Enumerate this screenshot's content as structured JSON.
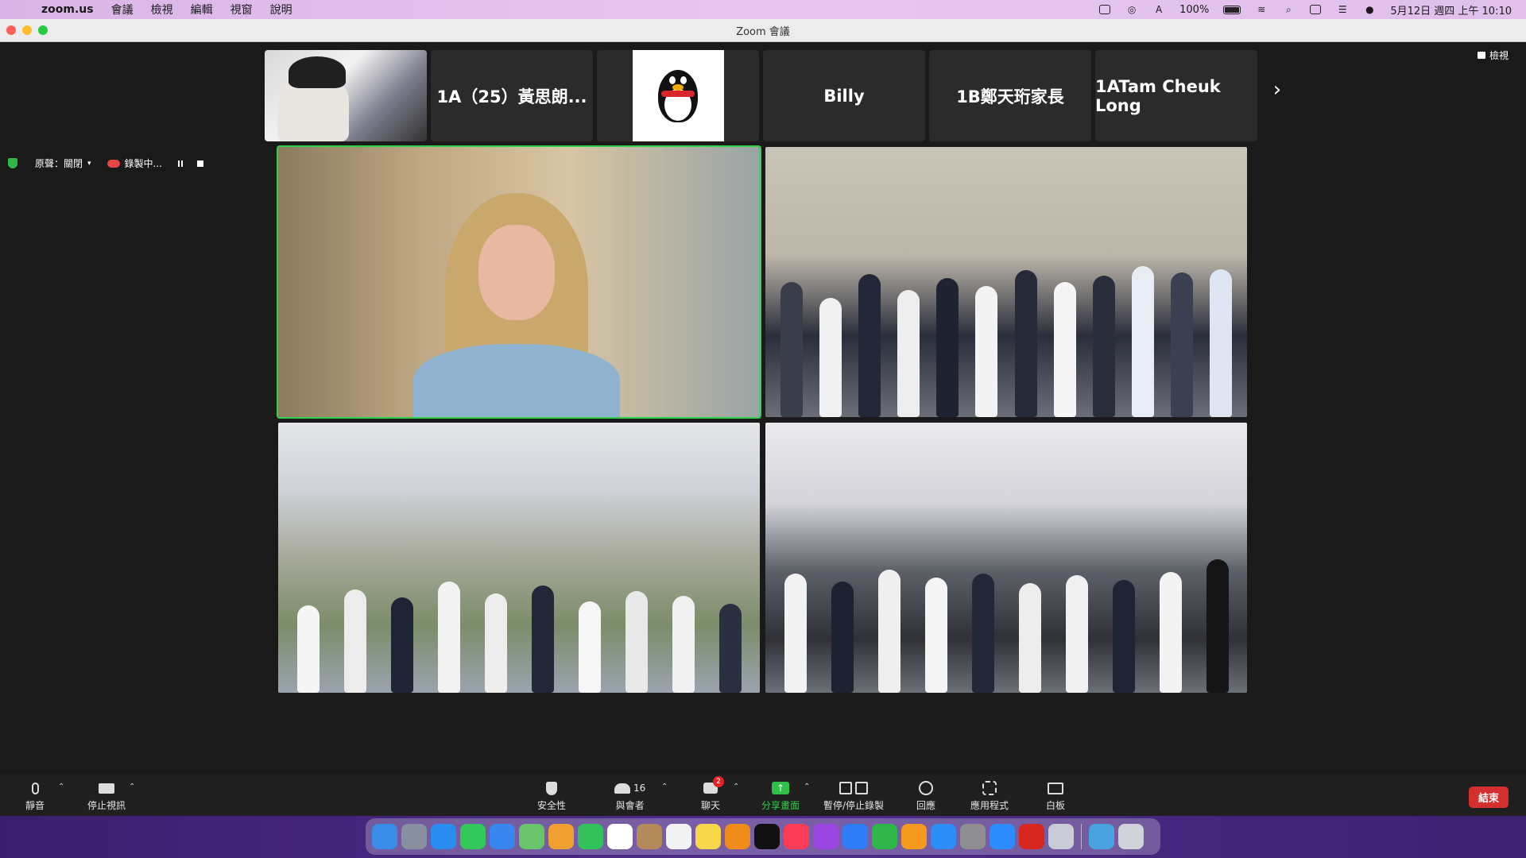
{
  "menubar": {
    "app_name": "zoom.us",
    "items": [
      "會議",
      "檢視",
      "編輯",
      "視窗",
      "說明"
    ],
    "battery": "100%",
    "datetime": "5月12日 週四 上午 10:10"
  },
  "window": {
    "title": "Zoom 會議"
  },
  "view_button": "檢視",
  "participants_strip": [
    {
      "type": "video",
      "name": ""
    },
    {
      "type": "name",
      "name": "1A（25）黃思朗..."
    },
    {
      "type": "avatar",
      "name": ""
    },
    {
      "type": "name",
      "name": "Billy"
    },
    {
      "type": "name",
      "name": "1B鄭天珩家長"
    },
    {
      "type": "name",
      "name": "1ATam Cheuk Long"
    }
  ],
  "status": {
    "original_sound": "原聲：關閉",
    "recording": "錄製中..."
  },
  "toolbar": {
    "mute": "靜音",
    "stop_video": "停止視訊",
    "security": "安全性",
    "participants": "與會者",
    "participants_count": "16",
    "chat": "聊天",
    "chat_badge": "2",
    "share_screen": "分享畫面",
    "pause_record": "暫停/停止錄製",
    "reactions": "回應",
    "apps": "應用程式",
    "whiteboard": "白板",
    "end": "結束"
  },
  "colors": {
    "active_speaker": "#2fd04a",
    "end_button": "#d32f2f",
    "share_green": "#2fc04a"
  }
}
